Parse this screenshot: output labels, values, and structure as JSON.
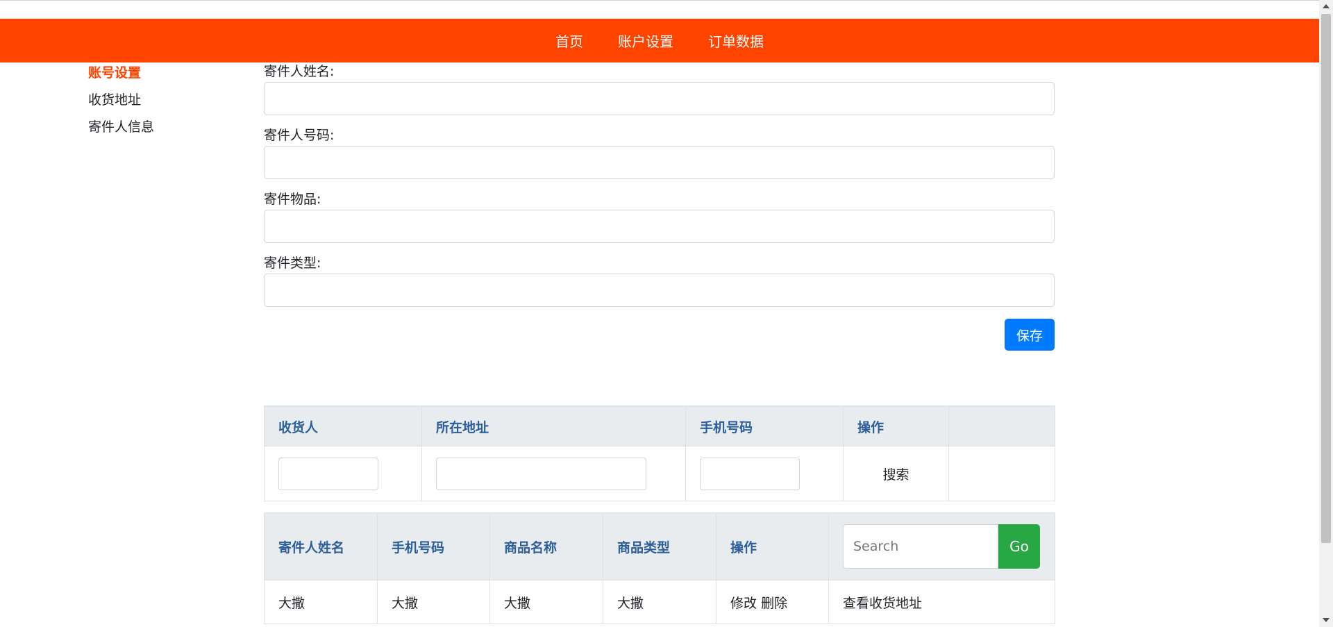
{
  "nav": {
    "items": [
      "首页",
      "账户设置",
      "订单数据"
    ]
  },
  "sidebar": {
    "items": [
      {
        "label": "账号设置",
        "active": true
      },
      {
        "label": "收货地址",
        "active": false
      },
      {
        "label": "寄件人信息",
        "active": false
      }
    ]
  },
  "form": {
    "fields": [
      {
        "label": "寄件人姓名:",
        "value": ""
      },
      {
        "label": "寄件人号码:",
        "value": ""
      },
      {
        "label": "寄件物品:",
        "value": ""
      },
      {
        "label": "寄件类型:",
        "value": ""
      }
    ],
    "save_label": "保存"
  },
  "address_table": {
    "headers": [
      "收货人",
      "所在地址",
      "手机号码",
      "操作",
      ""
    ],
    "search_label": "搜索"
  },
  "orders_table": {
    "headers": [
      "寄件人姓名",
      "手机号码",
      "商品名称",
      "商品类型",
      "操作"
    ],
    "search_placeholder": "Search",
    "go_label": "Go",
    "rows": [
      {
        "cells": [
          "大撒",
          "大撒",
          "大撒",
          "大撒"
        ],
        "edit": "修改",
        "delete": "删除",
        "view": "查看收货地址"
      }
    ]
  },
  "colors": {
    "brand": "#ff4400",
    "primary": "#007bff",
    "success": "#28a745",
    "header_text": "#2c5f99"
  }
}
